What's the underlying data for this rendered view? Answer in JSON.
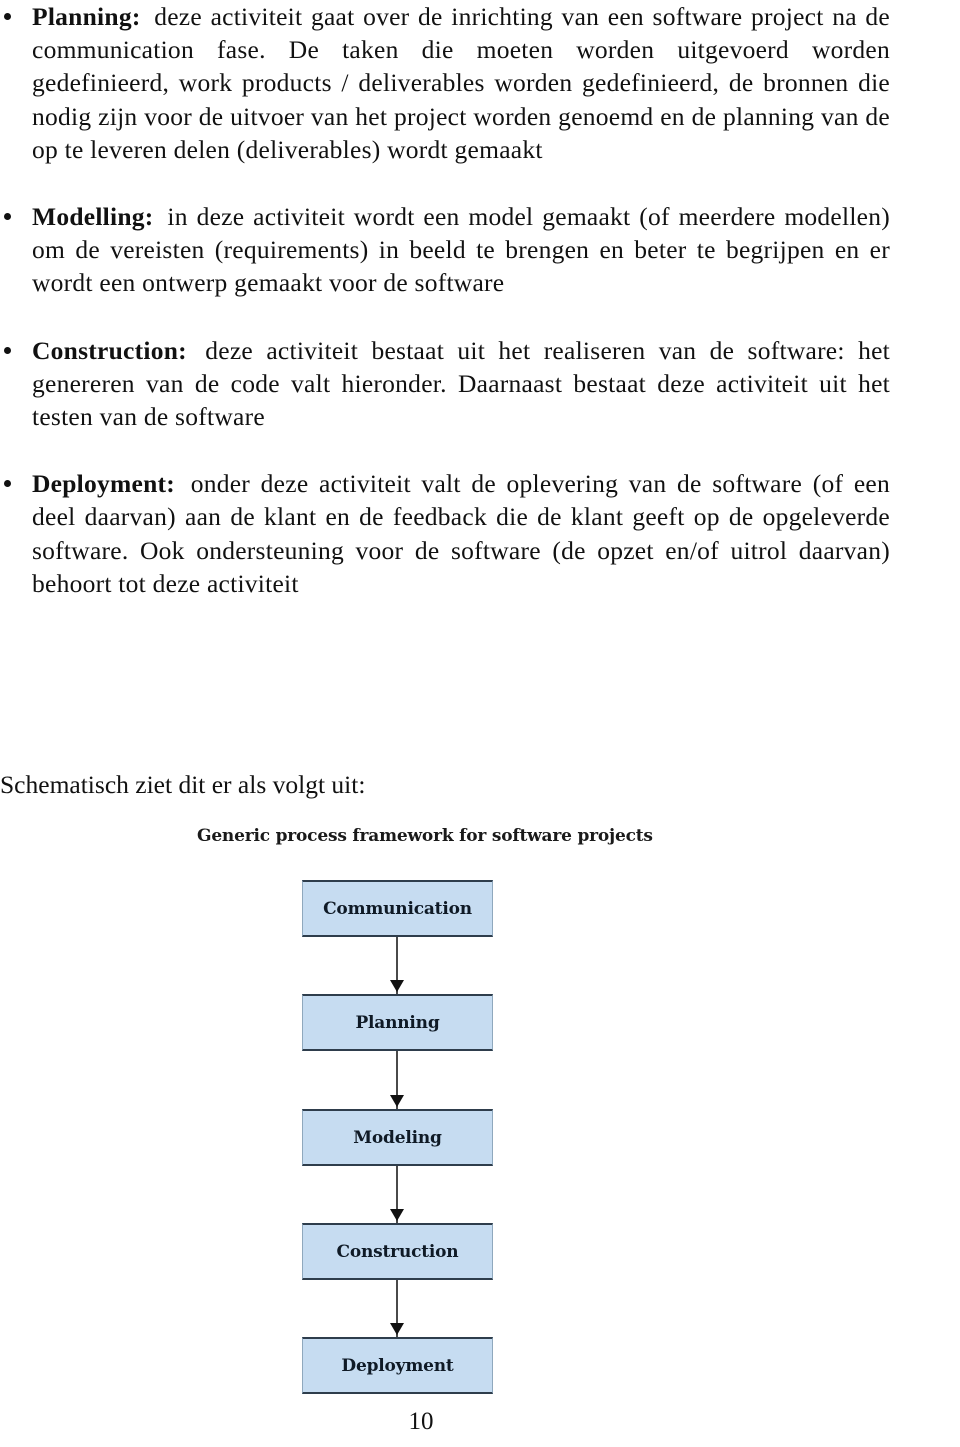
{
  "page": {
    "number": "10"
  },
  "content": {
    "bullets": [
      {
        "lead": "Planning:",
        "text": "deze activiteit gaat over de inrichting van een software project na de communication fase. De taken die moeten worden uitgevoerd worden gedefinieerd, work products / deliverables worden gedefinieerd, de bronnen die nodig zijn voor de uitvoer van het project worden genoemd en de planning van de op te leveren delen (deliverables) wordt gemaakt"
      },
      {
        "lead": "Modelling:",
        "text": "in deze activiteit wordt een model gemaakt (of meerdere modellen) om de vereisten (requirements) in beeld te brengen en beter te begrijpen en er wordt een ontwerp gemaakt voor de software"
      },
      {
        "lead": "Construction:",
        "text": "deze activiteit bestaat uit het realiseren van de software: het genereren van de code valt hieronder. Daarnaast bestaat deze activiteit uit het testen van de software"
      },
      {
        "lead": "Deployment:",
        "text": "onder deze activiteit valt de oplevering van de software (of een deel daarvan) aan de klant en de feedback die de klant geeft op de opgeleverde software. Ook ondersteuning voor de software (de opzet en/of uitrol daarvan) behoort tot deze activiteit"
      }
    ],
    "schema_intro": "Schematisch ziet dit er als volgt uit:"
  },
  "figure": {
    "title": "Generic process framework for software projects",
    "node_fill": "#c6dcf1",
    "node_border": "#2e3d4c",
    "nodes": [
      {
        "label": "Communication"
      },
      {
        "label": "Planning"
      },
      {
        "label": "Modeling"
      },
      {
        "label": "Construction"
      },
      {
        "label": "Deployment"
      }
    ]
  }
}
